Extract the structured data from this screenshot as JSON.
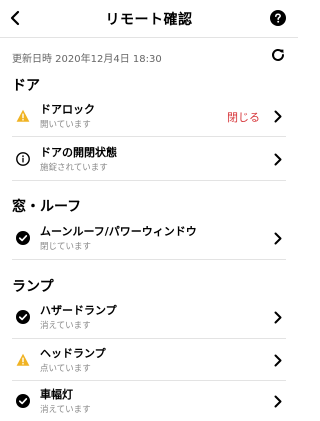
{
  "header": {
    "title": "リモート確認"
  },
  "updated": "更新日時 2020年12月4日 18:30",
  "sections": [
    {
      "title": "ドア",
      "items": [
        {
          "label": "ドアロック",
          "status": "開いています",
          "icon": "warning-icon",
          "action": "閉じる"
        },
        {
          "label": "ドアの開閉状態",
          "status": "施錠されています",
          "icon": "info-icon"
        }
      ]
    },
    {
      "title": "窓・ルーフ",
      "items": [
        {
          "label": "ムーンルーフ/パワーウィンドウ",
          "status": "閉じています",
          "icon": "check-circle-icon"
        }
      ]
    },
    {
      "title": "ランプ",
      "items": [
        {
          "label": "ハザードランプ",
          "status": "消えています",
          "icon": "check-circle-icon"
        },
        {
          "label": "ヘッドランプ",
          "status": "点いています",
          "icon": "warning-icon"
        },
        {
          "label": "車幅灯",
          "status": "消えています",
          "icon": "check-circle-icon"
        }
      ]
    }
  ],
  "colors": {
    "warning": "#f0b323",
    "action": "#d7373b",
    "text": "#000000",
    "subtext": "#8a8a8a",
    "divider": "#e3e3e3"
  }
}
